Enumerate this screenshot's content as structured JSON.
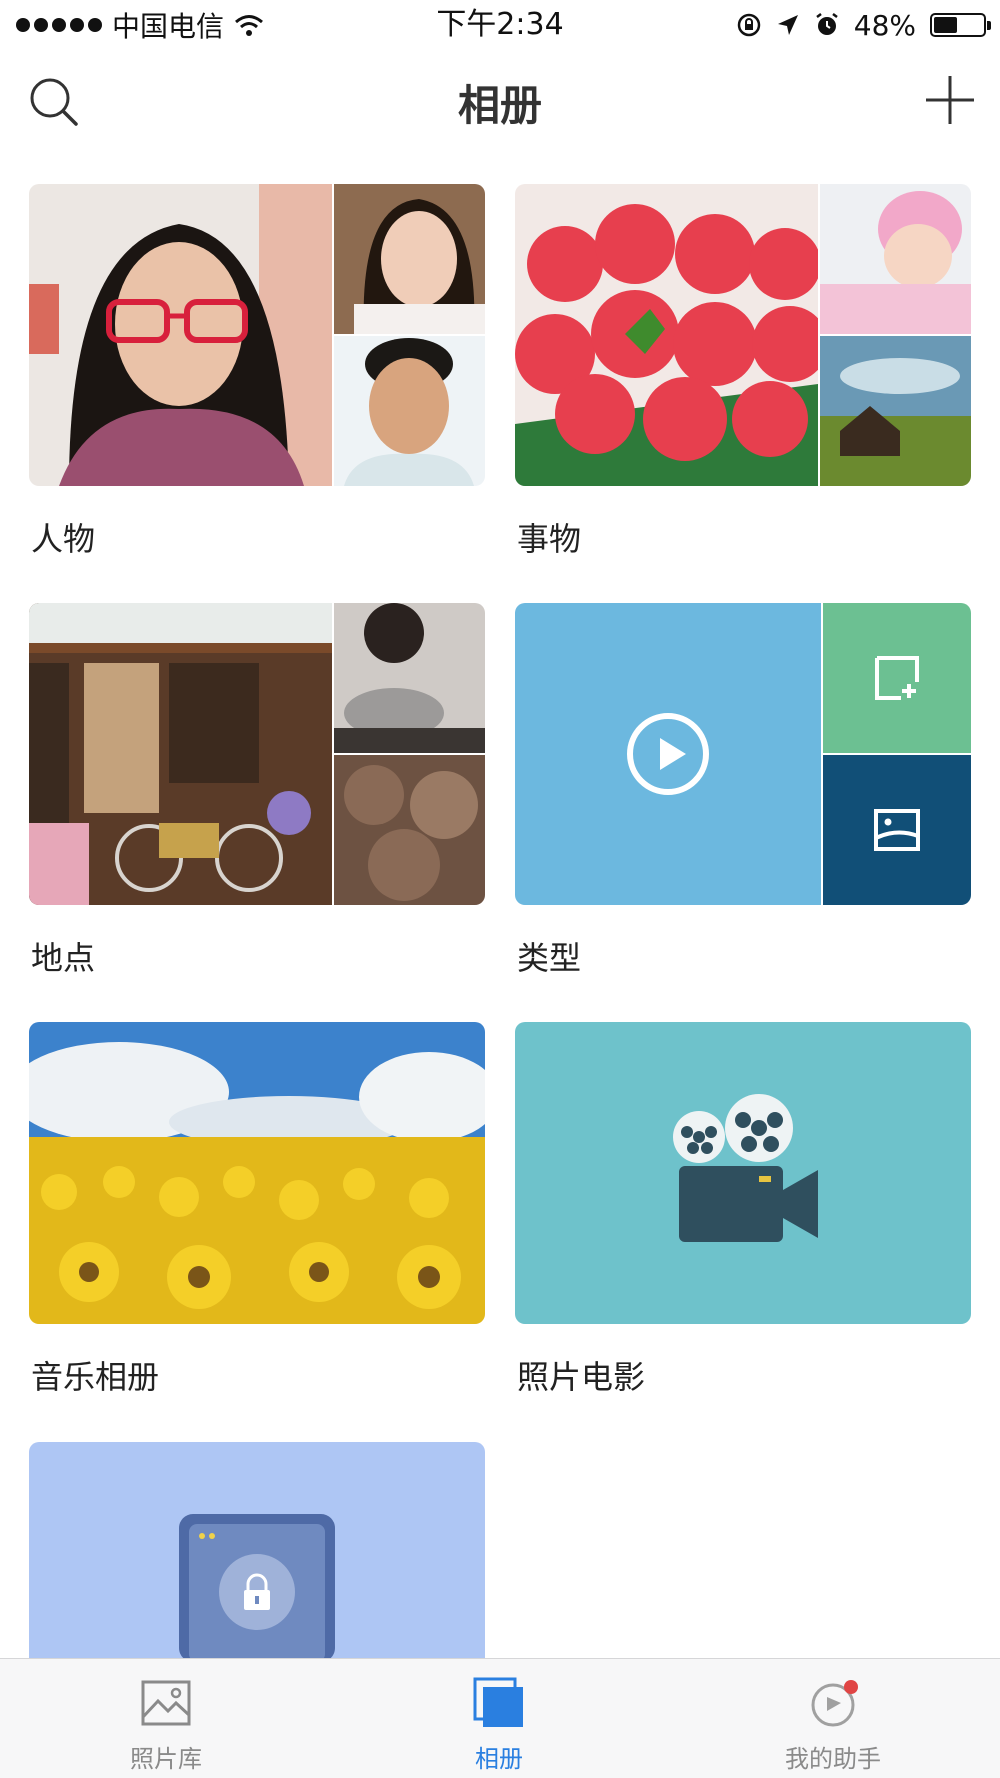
{
  "status_bar": {
    "carrier": "中国电信",
    "time": "下午2:34",
    "battery_text": "48%",
    "battery_level": 0.48
  },
  "nav": {
    "title": "相册"
  },
  "albums": [
    {
      "label": "人物"
    },
    {
      "label": "事物"
    },
    {
      "label": "地点"
    },
    {
      "label": "类型"
    },
    {
      "label": "音乐相册"
    },
    {
      "label": "照片电影"
    },
    {
      "label": ""
    }
  ],
  "tabbar": {
    "items": [
      {
        "label": "照片库",
        "icon": "photo-library-icon"
      },
      {
        "label": "相册",
        "icon": "albums-icon",
        "active": true
      },
      {
        "label": "我的助手",
        "icon": "assistant-icon"
      }
    ]
  },
  "colors": {
    "type_video": "#6cb8df",
    "type_green": "#6cc092",
    "type_dark": "#114f77",
    "movie_bg": "#6ec2cb",
    "lock_bg": "#aec6f4",
    "active_tab": "#2a7fe0"
  }
}
